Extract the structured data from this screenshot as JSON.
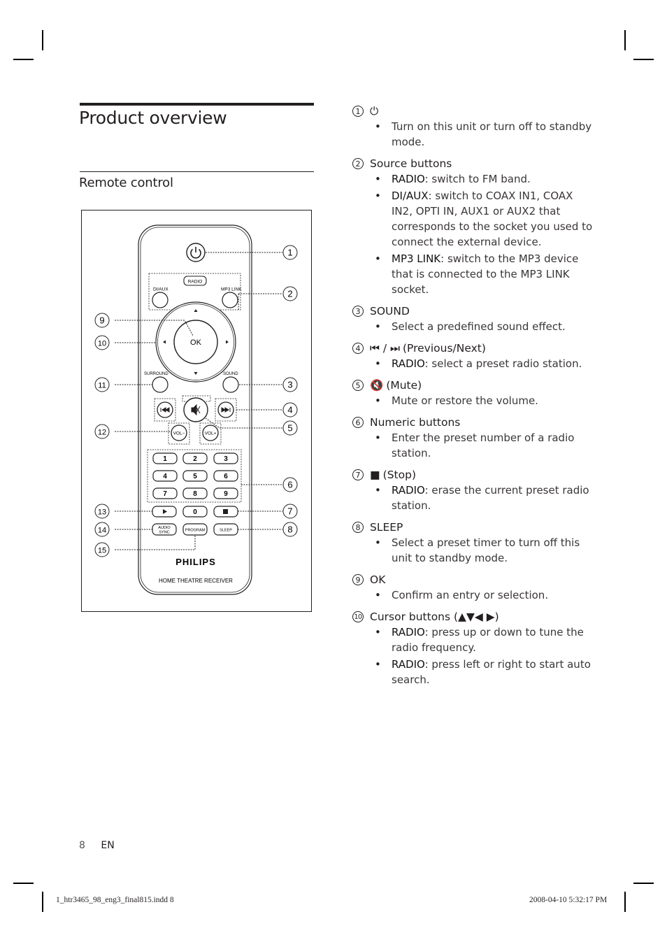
{
  "page": {
    "title": "Product overview",
    "section": "Remote control",
    "page_number": "8",
    "language": "EN",
    "slug_file": "1_htr3465_98_eng3_final815.indd   8",
    "slug_timestamp": "2008-04-10   5:32:17 PM"
  },
  "remote": {
    "buttons": {
      "power": "power-icon",
      "radio": "RADIO",
      "di_aux": "DI/AUX",
      "mp3_link": "MP3 LINK",
      "ok": "OK",
      "surround": "SURROUND",
      "sound": "SOUND",
      "vol_minus": "VOL−",
      "vol_plus": "VOL+",
      "keys": [
        "1",
        "2",
        "3",
        "4",
        "5",
        "6",
        "7",
        "8",
        "9",
        "0"
      ],
      "audio_sync_1": "AUDIO",
      "audio_sync_2": "SYNC",
      "program": "PROGRAM",
      "sleep": "SLEEP"
    },
    "brand": "PHILIPS",
    "model_label": "HOME THEATRE RECEIVER",
    "callouts": [
      "1",
      "2",
      "3",
      "4",
      "5",
      "6",
      "7",
      "8",
      "9",
      "10",
      "11",
      "12",
      "13",
      "14",
      "15"
    ]
  },
  "items": [
    {
      "num": "1",
      "glyph": "⏻",
      "label": "",
      "bullets": [
        {
          "bold": "",
          "text": "Turn on this unit or turn off to standby mode."
        }
      ]
    },
    {
      "num": "2",
      "glyph": "",
      "label": "Source buttons",
      "bullets": [
        {
          "bold": "RADIO",
          "text": ": switch to FM band."
        },
        {
          "bold": "DI/AUX",
          "text": ": switch to COAX IN1, COAX IN2, OPTI IN, AUX1 or AUX2 that corresponds to the socket you used to connect the external device."
        },
        {
          "bold": "MP3 LINK",
          "text": ": switch to the MP3 device that is connected to the MP3 LINK socket."
        }
      ]
    },
    {
      "num": "3",
      "glyph": "",
      "label": "SOUND",
      "bullets": [
        {
          "bold": "",
          "text": "Select a predefined sound effect."
        }
      ]
    },
    {
      "num": "4",
      "glyph": "⏮ / ⏭",
      "label": "(Previous/Next)",
      "bullets": [
        {
          "bold": "RADIO",
          "text": ": select a preset radio station."
        }
      ]
    },
    {
      "num": "5",
      "glyph": "🔇",
      "label": "(Mute)",
      "bullets": [
        {
          "bold": "",
          "text": "Mute or restore the volume."
        }
      ]
    },
    {
      "num": "6",
      "glyph": "",
      "label": "Numeric buttons",
      "bullets": [
        {
          "bold": "",
          "text": "Enter the preset number of a radio station."
        }
      ]
    },
    {
      "num": "7",
      "glyph": "■",
      "label": "(Stop)",
      "bullets": [
        {
          "bold": "RADIO",
          "text": ": erase the current preset radio station."
        }
      ]
    },
    {
      "num": "8",
      "glyph": "",
      "label": "SLEEP",
      "bullets": [
        {
          "bold": "",
          "text": "Select a preset timer to turn off this unit to standby mode."
        }
      ]
    },
    {
      "num": "9",
      "glyph": "",
      "label": "OK",
      "bullets": [
        {
          "bold": "",
          "text": "Confirm an entry or selection."
        }
      ]
    },
    {
      "num": "10",
      "glyph": "",
      "label": "Cursor buttons (▲▼◀ ▶)",
      "bullets": [
        {
          "bold": "RADIO",
          "text": ": press up or down to tune the radio frequency."
        },
        {
          "bold": "RADIO",
          "text": ": press left or right to start auto search."
        }
      ]
    }
  ]
}
